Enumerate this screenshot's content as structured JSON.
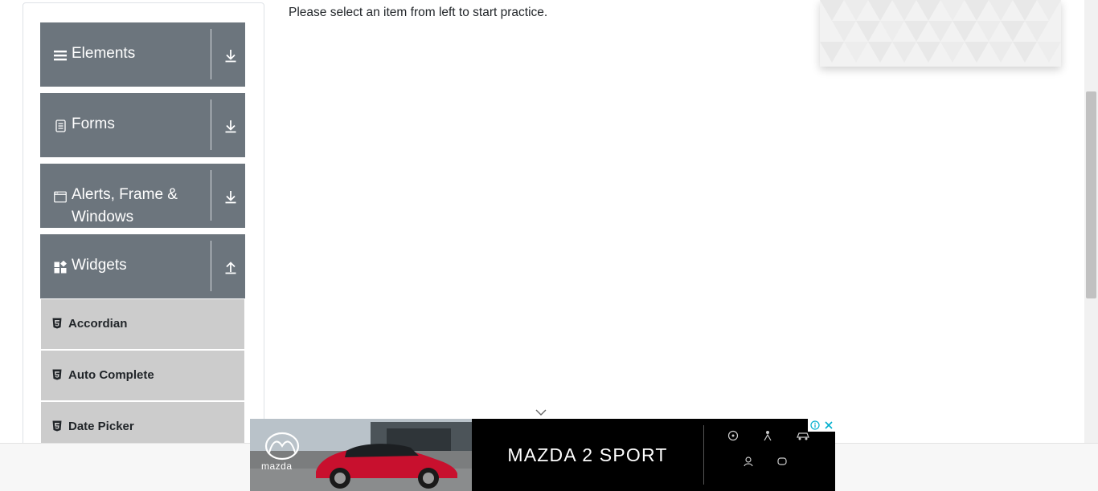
{
  "sidebar": {
    "groups": [
      {
        "title": "Elements",
        "icon": "hamburger-icon",
        "arrow": "download-arrow-icon",
        "expanded": false
      },
      {
        "title": "Forms",
        "icon": "form-icon",
        "arrow": "download-arrow-icon",
        "expanded": false
      },
      {
        "title": "Alerts, Frame & Windows",
        "icon": "window-icon",
        "arrow": "download-arrow-icon",
        "expanded": false
      },
      {
        "title": "Widgets",
        "icon": "widgets-icon",
        "arrow": "upload-arrow-icon",
        "expanded": true
      }
    ],
    "items": [
      {
        "label": "Accordian",
        "icon": "html5-icon"
      },
      {
        "label": "Auto Complete",
        "icon": "html5-icon"
      },
      {
        "label": "Date Picker",
        "icon": "html5-icon"
      }
    ]
  },
  "main": {
    "intro_text": "Please select an item from left to start practice."
  },
  "ad": {
    "brand": "mazda",
    "headline": "MAZDA 2 SPORT",
    "info_icon": "info-icon",
    "close_icon": "close-icon"
  },
  "colors": {
    "group_header_bg": "#6c757d",
    "menu_item_bg": "#cccccc",
    "ad_bg": "#000000",
    "car_red": "#c8102e"
  }
}
